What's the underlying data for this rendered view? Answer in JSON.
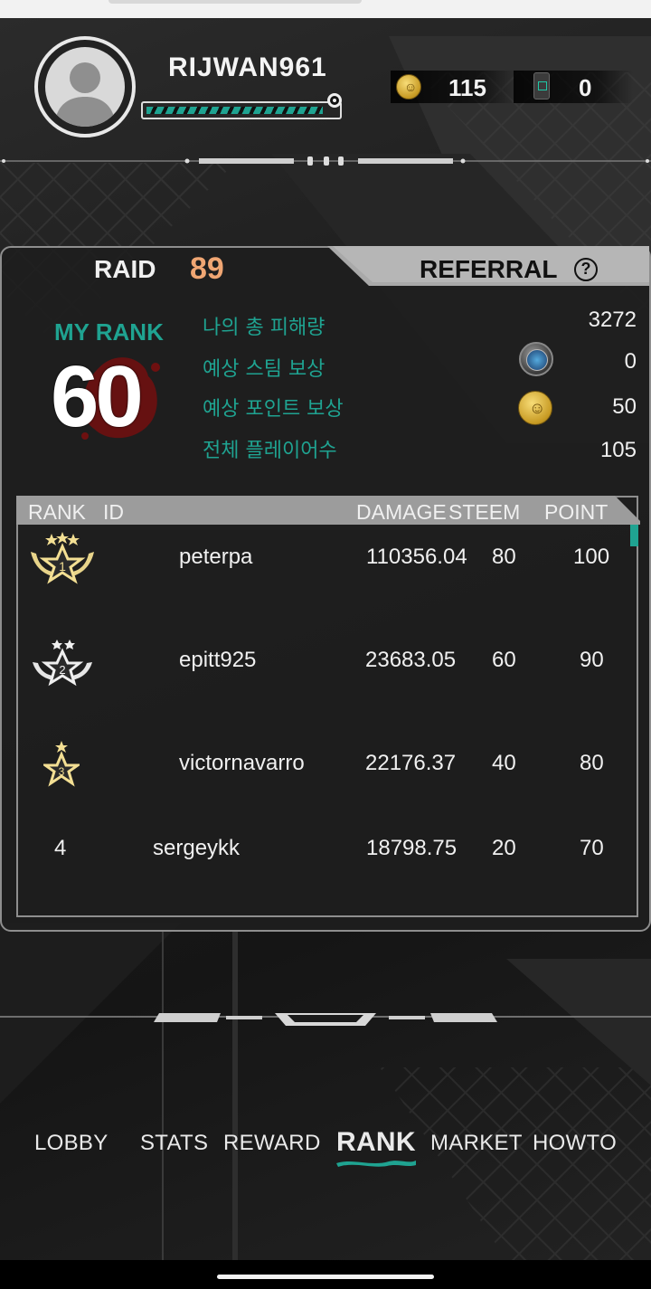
{
  "header": {
    "username": "RIJWAN961",
    "xp_progress": 0.93,
    "gold_amount": "115",
    "phone_amount": "0"
  },
  "panel": {
    "raid_label": "RAID",
    "raid_number": "89",
    "referral_label": "REFERRAL",
    "help_glyph": "?",
    "my_rank_label": "MY RANK",
    "my_rank_value": "60",
    "stats": [
      {
        "label": "나의 총 피해량",
        "value": "3272"
      },
      {
        "label": "예상 스팀 보상",
        "value": "0"
      },
      {
        "label": "예상 포인트 보상",
        "value": "50"
      },
      {
        "label": "전체 플레이어수",
        "value": "105"
      }
    ]
  },
  "table": {
    "columns": [
      "RANK",
      "ID",
      "DAMAGE",
      "STEEM",
      "POINT"
    ],
    "rows": [
      {
        "rank": "1",
        "id": "peterpa",
        "damage": "110356.04",
        "steem": "80",
        "point": "100"
      },
      {
        "rank": "2",
        "id": "epitt925",
        "damage": "23683.05",
        "steem": "60",
        "point": "90"
      },
      {
        "rank": "3",
        "id": "victornavarro",
        "damage": "22176.37",
        "steem": "40",
        "point": "80"
      },
      {
        "rank": "4",
        "id": "sergeykk",
        "damage": "18798.75",
        "steem": "20",
        "point": "70"
      }
    ]
  },
  "nav": {
    "items": [
      "LOBBY",
      "STATS",
      "REWARD",
      "RANK",
      "MARKET",
      "HOWTO"
    ],
    "active": "RANK"
  },
  "colors": {
    "accent_teal": "#1fa391",
    "raid_orange": "#f0a673",
    "gold": "#c79a23"
  },
  "icons": [
    "avatar-icon",
    "gold-coin-icon",
    "phone-icon",
    "help-icon",
    "steem-icon",
    "rank-badge-icon"
  ]
}
